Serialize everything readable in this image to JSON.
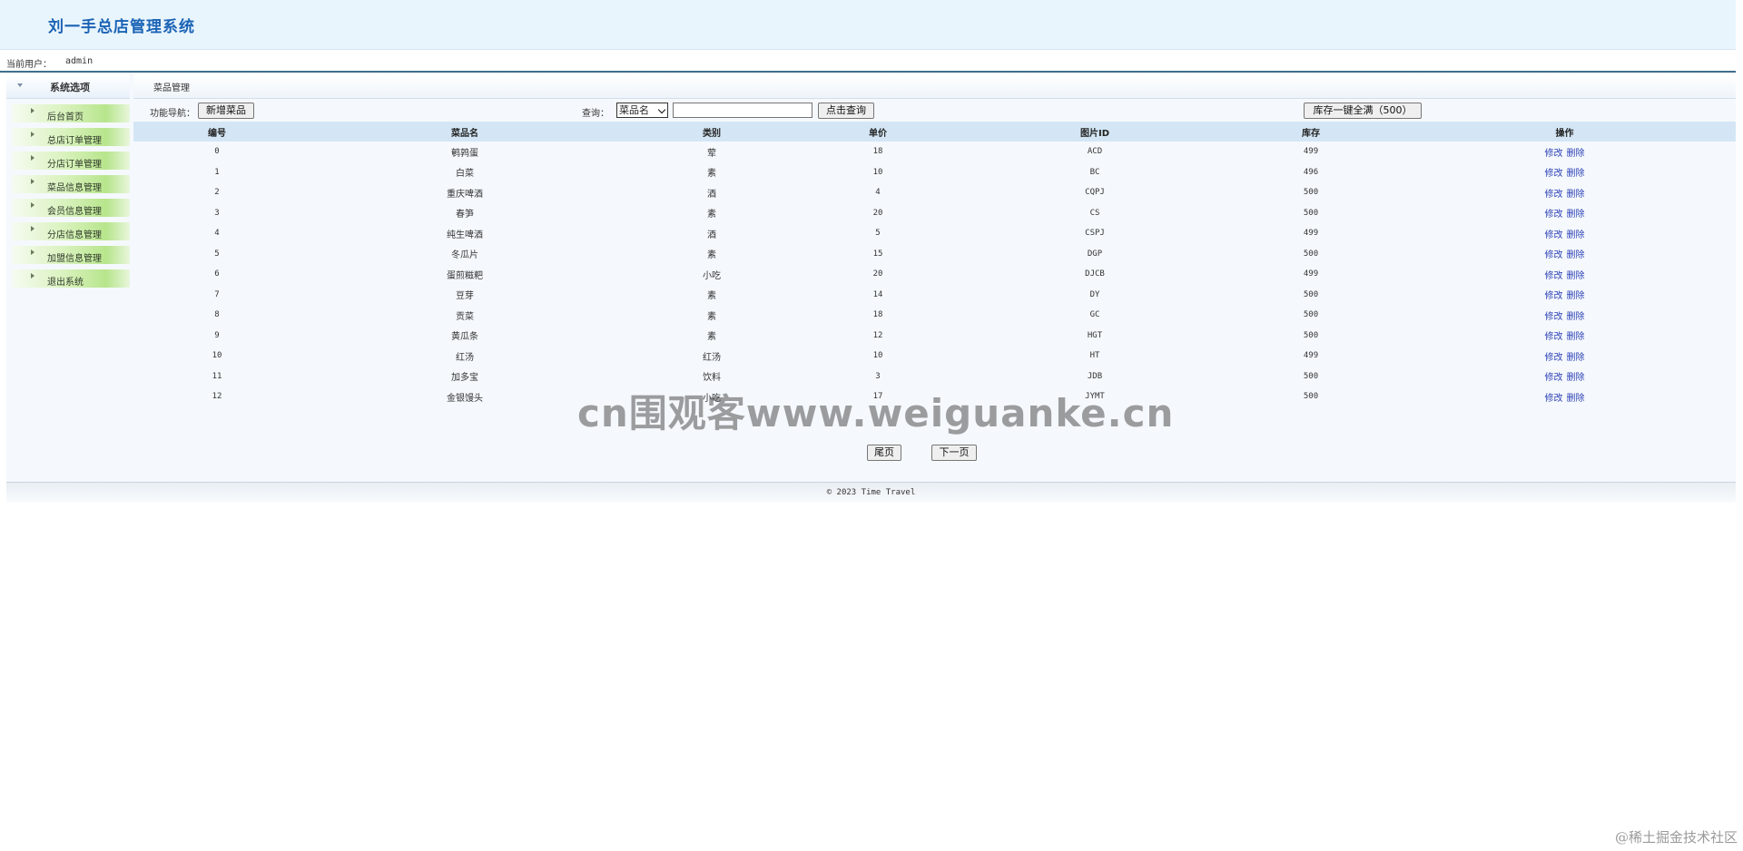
{
  "header": {
    "title": "刘一手总店管理系统"
  },
  "userbar": {
    "label": "当前用户：",
    "username": "admin"
  },
  "sidebar": {
    "heading": "系统选项",
    "items": [
      {
        "label": "后台首页"
      },
      {
        "label": "总店订单管理"
      },
      {
        "label": "分店订单管理"
      },
      {
        "label": "菜品信息管理"
      },
      {
        "label": "会员信息管理"
      },
      {
        "label": "分店信息管理"
      },
      {
        "label": "加盟信息管理"
      },
      {
        "label": "退出系统"
      }
    ]
  },
  "breadcrumb": {
    "text": "菜品管理"
  },
  "toolbar": {
    "nav_label": "功能导航：",
    "add_button": "新增菜品",
    "query_label": "查询：",
    "select_value": "菜品名",
    "search_value": "",
    "search_button": "点击查询",
    "restock_button": "库存一键全满（500）"
  },
  "table": {
    "headers": [
      "编号",
      "菜品名",
      "类别",
      "单价",
      "图片ID",
      "库存",
      "操作"
    ],
    "edit_label": "修改",
    "delete_label": "删除",
    "rows": [
      [
        "0",
        "鹌鹑蛋",
        "荤",
        "18",
        "ACD",
        "499"
      ],
      [
        "1",
        "白菜",
        "素",
        "10",
        "BC",
        "496"
      ],
      [
        "2",
        "重庆啤酒",
        "酒",
        "4",
        "CQPJ",
        "500"
      ],
      [
        "3",
        "春笋",
        "素",
        "20",
        "CS",
        "500"
      ],
      [
        "4",
        "纯生啤酒",
        "酒",
        "5",
        "CSPJ",
        "499"
      ],
      [
        "5",
        "冬瓜片",
        "素",
        "15",
        "DGP",
        "500"
      ],
      [
        "6",
        "蛋煎糍粑",
        "小吃",
        "20",
        "DJCB",
        "499"
      ],
      [
        "7",
        "豆芽",
        "素",
        "14",
        "DY",
        "500"
      ],
      [
        "8",
        "贡菜",
        "素",
        "18",
        "GC",
        "500"
      ],
      [
        "9",
        "黄瓜条",
        "素",
        "12",
        "HGT",
        "500"
      ],
      [
        "10",
        "红汤",
        "红汤",
        "10",
        "HT",
        "499"
      ],
      [
        "11",
        "加多宝",
        "饮料",
        "3",
        "JDB",
        "500"
      ],
      [
        "12",
        "金银馒头",
        "小吃",
        "17",
        "JYMT",
        "500"
      ]
    ]
  },
  "pager": {
    "last": "尾页",
    "next": "下一页"
  },
  "footer": {
    "text": "© 2023 Time Travel"
  },
  "watermark": {
    "text": "cn围观客www.weiguanke.cn"
  },
  "corner_mark": {
    "text": "@稀土掘金技术社区"
  }
}
